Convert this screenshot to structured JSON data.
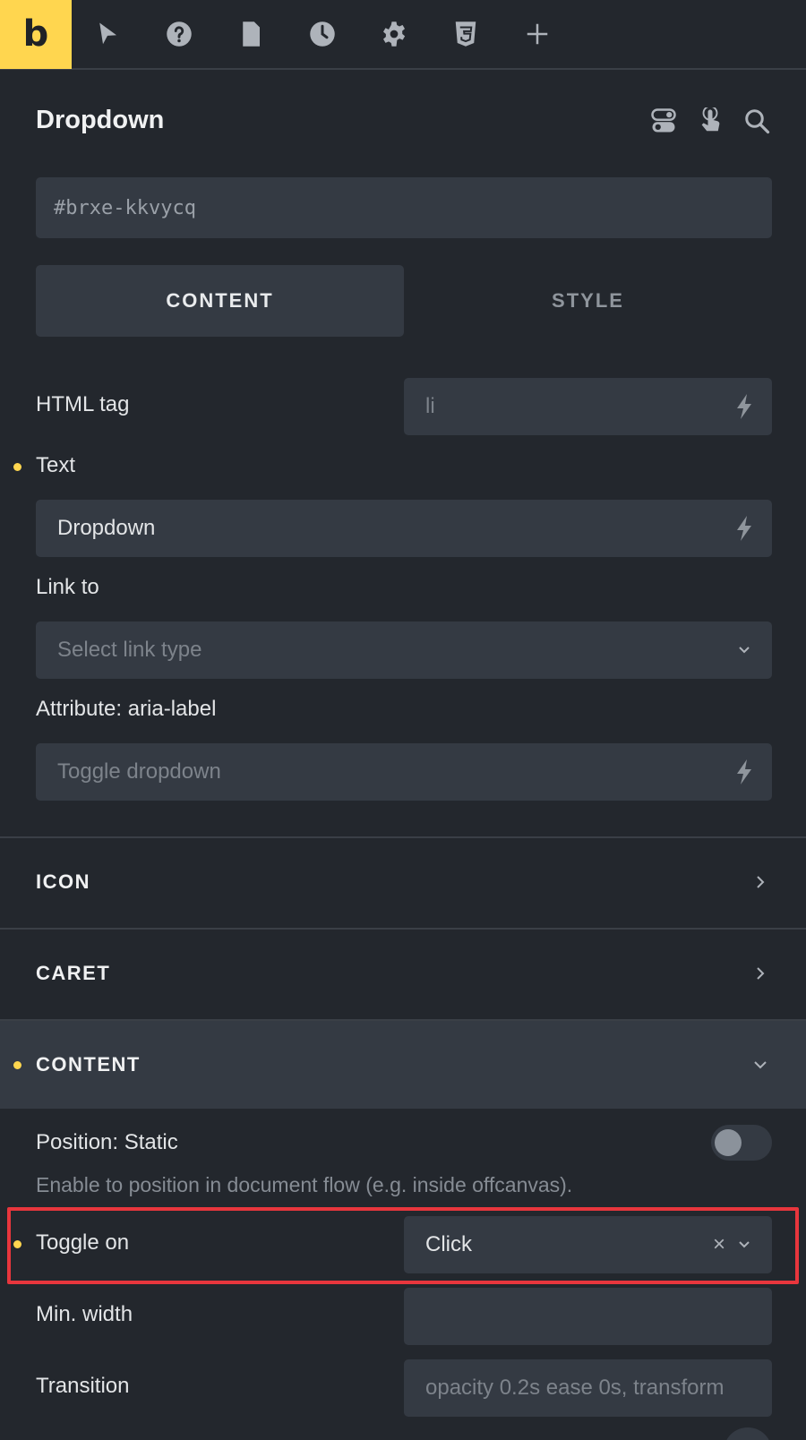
{
  "topbar": {
    "logo": "b",
    "icons": [
      "cursor-icon",
      "help-icon",
      "page-icon",
      "history-icon",
      "settings-icon",
      "css3-icon",
      "add-icon"
    ]
  },
  "panel": {
    "title": "Dropdown",
    "element_id": "#brxe-kkvycq",
    "tabs": {
      "content": "CONTENT",
      "style": "STYLE"
    }
  },
  "fields": {
    "html_tag": {
      "label": "HTML tag",
      "placeholder": "li"
    },
    "text": {
      "label": "Text",
      "value": "Dropdown"
    },
    "link_to": {
      "label": "Link to",
      "placeholder": "Select link type"
    },
    "aria_label": {
      "label": "Attribute: aria-label",
      "placeholder": "Toggle dropdown"
    }
  },
  "sections": {
    "icon": "ICON",
    "caret": "CARET",
    "content": "CONTENT"
  },
  "content_settings": {
    "position_static": {
      "label": "Position: Static",
      "enabled": false
    },
    "position_hint": "Enable to position in document flow (e.g. inside offcanvas).",
    "toggle_on": {
      "label": "Toggle on",
      "value": "Click",
      "clear": "×"
    },
    "min_width": {
      "label": "Min. width",
      "value": ""
    },
    "transition": {
      "label": "Transition",
      "placeholder": "opacity 0.2s ease 0s, transform"
    }
  },
  "colors": {
    "accent": "#ffd64f",
    "highlight": "#e8363d",
    "bg": "#23272d",
    "field": "#343a43"
  }
}
